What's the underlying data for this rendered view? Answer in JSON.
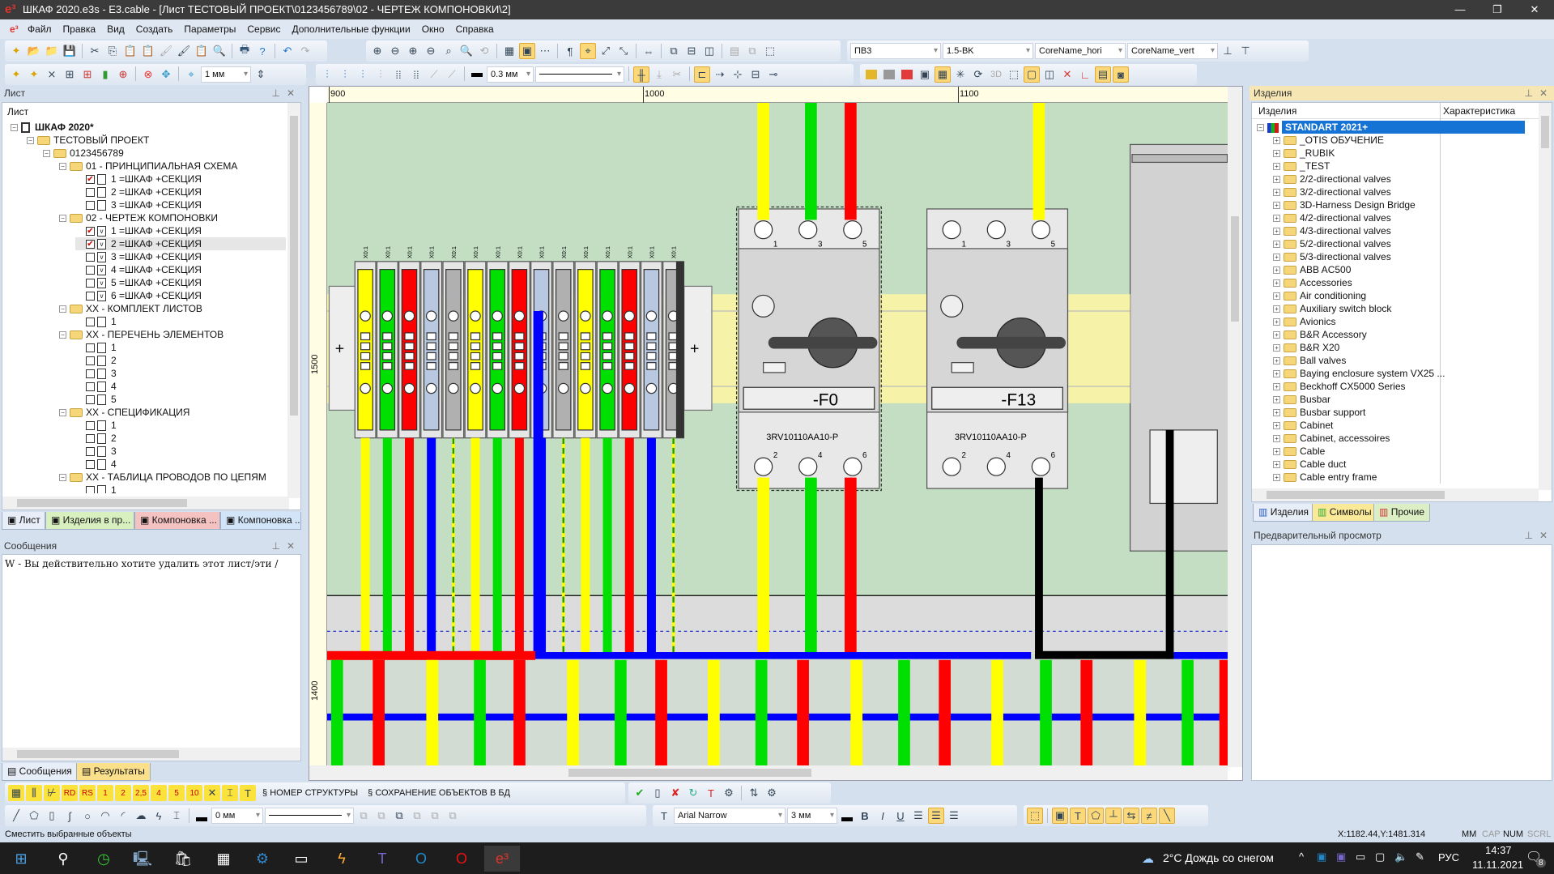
{
  "window": {
    "title": "ШКАФ 2020.e3s - E3.cable - [Лист ТЕСТОВЫЙ ПРОЕКТ\\0123456789\\02 - ЧЕРТЕЖ КОМПОНОВКИ\\2]"
  },
  "menu": [
    "Файл",
    "Правка",
    "Вид",
    "Создать",
    "Параметры",
    "Сервис",
    "Дополнительные функции",
    "Окно",
    "Справка"
  ],
  "toolbar": {
    "line_width": "1 мм",
    "stroke_width": "0.3 мм",
    "wire_type": "ПВ3",
    "wire_spec": "1.5-BK",
    "core_name_hori": "CoreName_hori",
    "core_name_vert": "CoreName_vert",
    "label_3d": "3D"
  },
  "sheet_panel": {
    "title": "Лист",
    "column": "Лист",
    "tree": [
      {
        "level": 0,
        "kind": "root",
        "label": "ШКАФ 2020*",
        "exp": "−"
      },
      {
        "level": 1,
        "kind": "folder",
        "label": "ТЕСТОВЫЙ ПРОЕКТ",
        "exp": "−"
      },
      {
        "level": 2,
        "kind": "folder",
        "label": "0123456789",
        "exp": "−"
      },
      {
        "level": 3,
        "kind": "folder",
        "label": "01 - ПРИНЦИПИАЛЬНАЯ СХЕМА",
        "exp": "−"
      },
      {
        "level": 4,
        "kind": "sheet",
        "label": "1 =ШКАФ +СЕКЦИЯ",
        "checked": true
      },
      {
        "level": 4,
        "kind": "sheet",
        "label": "2 =ШКАФ +СЕКЦИЯ",
        "checked": false
      },
      {
        "level": 4,
        "kind": "sheet",
        "label": "3 =ШКАФ +СЕКЦИЯ",
        "checked": false
      },
      {
        "level": 3,
        "kind": "folder",
        "label": "02 - ЧЕРТЕЖ КОМПОНОВКИ",
        "exp": "−"
      },
      {
        "level": 4,
        "kind": "layout",
        "label": "1 =ШКАФ +СЕКЦИЯ",
        "checked": true
      },
      {
        "level": 4,
        "kind": "layout",
        "label": "2 =ШКАФ +СЕКЦИЯ",
        "checked": true,
        "selected": true
      },
      {
        "level": 4,
        "kind": "layout",
        "label": "3 =ШКАФ +СЕКЦИЯ",
        "checked": false
      },
      {
        "level": 4,
        "kind": "layout",
        "label": "4 =ШКАФ +СЕКЦИЯ",
        "checked": false
      },
      {
        "level": 4,
        "kind": "layout",
        "label": "5 =ШКАФ +СЕКЦИЯ",
        "checked": false
      },
      {
        "level": 4,
        "kind": "layout",
        "label": "6 =ШКАФ +СЕКЦИЯ",
        "checked": false
      },
      {
        "level": 3,
        "kind": "folder",
        "label": "XX - КОМПЛЕКТ ЛИСТОВ",
        "exp": "−"
      },
      {
        "level": 4,
        "kind": "sheet",
        "label": "1",
        "checked": false
      },
      {
        "level": 3,
        "kind": "folder",
        "label": "XX - ПЕРЕЧЕНЬ ЭЛЕМЕНТОВ",
        "exp": "−"
      },
      {
        "level": 4,
        "kind": "sheet",
        "label": "1",
        "checked": false
      },
      {
        "level": 4,
        "kind": "sheet",
        "label": "2",
        "checked": false
      },
      {
        "level": 4,
        "kind": "sheet",
        "label": "3",
        "checked": false
      },
      {
        "level": 4,
        "kind": "sheet",
        "label": "4",
        "checked": false
      },
      {
        "level": 4,
        "kind": "sheet",
        "label": "5",
        "checked": false
      },
      {
        "level": 3,
        "kind": "folder",
        "label": "XX - СПЕЦИФИКАЦИЯ",
        "exp": "−"
      },
      {
        "level": 4,
        "kind": "sheet",
        "label": "1",
        "checked": false
      },
      {
        "level": 4,
        "kind": "sheet",
        "label": "2",
        "checked": false
      },
      {
        "level": 4,
        "kind": "sheet",
        "label": "3",
        "checked": false
      },
      {
        "level": 4,
        "kind": "sheet",
        "label": "4",
        "checked": false
      },
      {
        "level": 3,
        "kind": "folder",
        "label": "XX - ТАБЛИЦА ПРОВОДОВ ПО ЦЕПЯМ",
        "exp": "−"
      },
      {
        "level": 4,
        "kind": "sheet",
        "label": "1",
        "checked": false
      }
    ],
    "tabs": [
      {
        "label": "Лист",
        "color": "#e8eef7"
      },
      {
        "label": "Изделия в пр...",
        "color": "#d8f0c0"
      },
      {
        "label": "Компоновка ...",
        "color": "#f5c2c2"
      },
      {
        "label": "Компоновка ...",
        "color": "#d2e4f7"
      }
    ]
  },
  "messages_panel": {
    "title": "Сообщения",
    "lines": [
      "W - Вы действительно хотите удалить этот лист/эти /"
    ],
    "tabs": [
      "Сообщения",
      "Результаты"
    ]
  },
  "canvas": {
    "ruler_top": [
      "900",
      "1000",
      "1100"
    ],
    "ruler_left": [
      "1500",
      "1400"
    ],
    "devices": [
      {
        "tag": "-F0",
        "part": "3RV10110AA10-P",
        "top_pins": [
          "1",
          "3",
          "5"
        ],
        "bottom_pins": [
          "2",
          "4",
          "6"
        ]
      },
      {
        "tag": "-F13",
        "part": "3RV10110AA10-P",
        "top_pins": [
          "1",
          "3",
          "5"
        ],
        "bottom_pins": [
          "2",
          "4",
          "6"
        ]
      }
    ],
    "terminal_label": "X0:1",
    "terminal_colors": [
      "#ffff00",
      "#00e000",
      "#ff0000",
      "#b8c8e0",
      "#b0b0b0",
      "#ffff00",
      "#00e000",
      "#ff0000",
      "#b8c8e0",
      "#b0b0b0",
      "#ffff00",
      "#00e000",
      "#ff0000",
      "#b8c8e0",
      "#b0b0b0"
    ],
    "colors": {
      "background": "#c3dec3",
      "rail": "#f6f2a8",
      "yellow": "#ffff00",
      "green": "#00e000",
      "red": "#ff0000",
      "blue": "#0000ff",
      "black": "#000000"
    }
  },
  "parts_panel": {
    "title": "Изделия",
    "columns": [
      "Изделия",
      "Характеристика"
    ],
    "root": "STANDART 2021+",
    "items": [
      "_OTIS ОБУЧЕНИЕ",
      "_RUBIK",
      "_TEST",
      "2/2-directional valves",
      "3/2-directional valves",
      "3D-Harness Design Bridge",
      "4/2-directional valves",
      "4/3-directional valves",
      "5/2-directional valves",
      "5/3-directional valves",
      "ABB AC500",
      "Accessories",
      "Air conditioning",
      "Auxiliary switch block",
      "Avionics",
      "B&R Accessory",
      "B&R X20",
      "Ball valves",
      "Baying enclosure system VX25 ...",
      "Beckhoff CX5000 Series",
      "Busbar",
      "Busbar support",
      "Cabinet",
      "Cabinet, accessoires",
      "Cable",
      "Cable duct",
      "Cable entry frame"
    ],
    "tabs": [
      "Изделия",
      "Символы",
      "Прочие"
    ],
    "preview_title": "Предварительный просмотр"
  },
  "bottom_toolbar": {
    "text_buttons": [
      "RD",
      "RS",
      "1",
      "2",
      "2,5",
      "4",
      "5",
      "10"
    ],
    "structure_number": "НОМЕР СТРУКТУРЫ",
    "save_to_db": "СОХРАНЕНИЕ ОБЪЕКТОВ В БД",
    "line_width": "0 мм",
    "font": "Arial Narrow",
    "font_size": "3 мм"
  },
  "status": {
    "hint": "Сместить выбранные объекты",
    "coords": "X:1182.44,Y:1481.314",
    "indicators": [
      "MM",
      "CAP",
      "NUM",
      "SCRL"
    ]
  },
  "taskbar": {
    "weather": "2°C  Дождь со снегом",
    "lang": "РУС",
    "time": "14:37",
    "date": "11.11.2021",
    "notifications": "8"
  }
}
